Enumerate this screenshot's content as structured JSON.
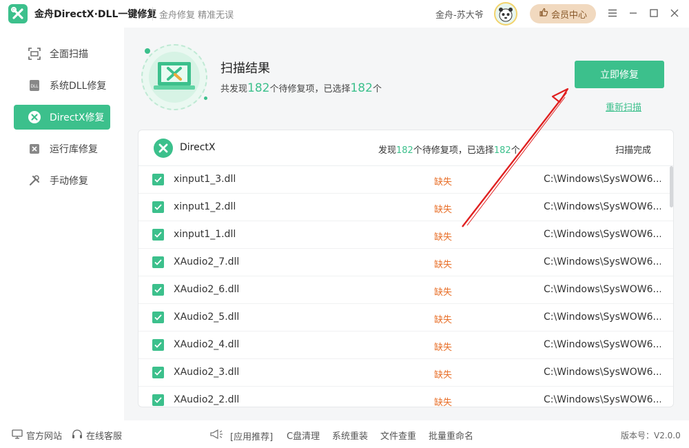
{
  "titlebar": {
    "app_title": "金舟DirectX·DLL一键修复",
    "slogan": "金舟修复 精准无误",
    "user_name": "金舟-苏大爷",
    "vip_label": "会员中心"
  },
  "sidebar": {
    "items": [
      {
        "label": "全面扫描",
        "icon": "scan-icon"
      },
      {
        "label": "系统DLL修复",
        "icon": "dll-icon"
      },
      {
        "label": "DirectX修复",
        "icon": "directx-icon",
        "active": true
      },
      {
        "label": "运行库修复",
        "icon": "runtime-icon"
      },
      {
        "label": "手动修复",
        "icon": "tools-icon"
      }
    ]
  },
  "result": {
    "title": "扫描结果",
    "prefix": "共发现",
    "found_count": "182",
    "middle": "个待修复项，已选择",
    "selected_count": "182",
    "suffix": "个",
    "repair_button": "立即修复",
    "rescan_link": "重新扫描"
  },
  "panel": {
    "group_name": "DirectX",
    "found_prefix": "发现",
    "found_count": "182",
    "found_middle": "个待修复项，已选择",
    "selected_count": "182",
    "found_suffix": "个",
    "status": "扫描完成",
    "rows": [
      {
        "name": "xinput1_3.dll",
        "status": "缺失",
        "path": "C:\\Windows\\SysWOW6..."
      },
      {
        "name": "xinput1_2.dll",
        "status": "缺失",
        "path": "C:\\Windows\\SysWOW6..."
      },
      {
        "name": "xinput1_1.dll",
        "status": "缺失",
        "path": "C:\\Windows\\SysWOW6..."
      },
      {
        "name": "XAudio2_7.dll",
        "status": "缺失",
        "path": "C:\\Windows\\SysWOW6..."
      },
      {
        "name": "XAudio2_6.dll",
        "status": "缺失",
        "path": "C:\\Windows\\SysWOW6..."
      },
      {
        "name": "XAudio2_5.dll",
        "status": "缺失",
        "path": "C:\\Windows\\SysWOW6..."
      },
      {
        "name": "XAudio2_4.dll",
        "status": "缺失",
        "path": "C:\\Windows\\SysWOW6..."
      },
      {
        "name": "XAudio2_3.dll",
        "status": "缺失",
        "path": "C:\\Windows\\SysWOW6..."
      },
      {
        "name": "XAudio2_2.dll",
        "status": "缺失",
        "path": "C:\\Windows\\SysWOW6..."
      }
    ]
  },
  "footer": {
    "website": "官方网站",
    "service": "在线客服",
    "recommend": "[应用推荐]",
    "links": [
      "C盘清理",
      "系统重装",
      "文件查重",
      "批量重命名"
    ],
    "version": "版本号：V2.0.0"
  },
  "colors": {
    "accent": "#3cc08c",
    "warning": "#e8702a",
    "vip_bg": "#f1d9bf",
    "annotation_arrow": "#e02020"
  }
}
